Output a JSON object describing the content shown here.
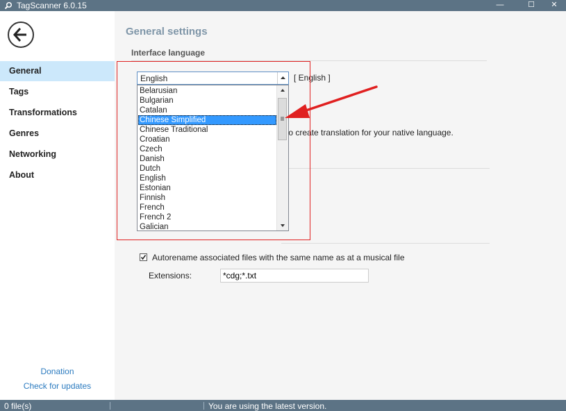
{
  "window": {
    "title": "TagScanner 6.0.15",
    "controls": {
      "minimize": "—",
      "maximize": "☐",
      "close": "✕"
    }
  },
  "sidebar": {
    "items": [
      {
        "label": "General",
        "active": true
      },
      {
        "label": "Tags",
        "active": false
      },
      {
        "label": "Transformations",
        "active": false
      },
      {
        "label": "Genres",
        "active": false
      },
      {
        "label": "Networking",
        "active": false
      },
      {
        "label": "About",
        "active": false
      }
    ],
    "donation": "Donation",
    "check_updates": "Check for updates"
  },
  "main": {
    "page_title": "General settings",
    "interface_language": {
      "section_title": "Interface language",
      "selected": "English",
      "current": "[ English ]",
      "hint_partial": "to create translation for your native language.",
      "options": [
        "Belarusian",
        "Bulgarian",
        "Catalan",
        "Chinese Simplified",
        "Chinese Traditional",
        "Croatian",
        "Czech",
        "Danish",
        "Dutch",
        "English",
        "Estonian",
        "Finnish",
        "French",
        "French 2",
        "Galician"
      ],
      "highlighted_option": "Chinese Simplified"
    },
    "autorename": {
      "checked": true,
      "label": "Autorename associated files with the same name as at a musical file",
      "extensions_label": "Extensions:",
      "extensions_value": "*cdg;*.txt"
    }
  },
  "statusbar": {
    "files": "0 file(s)",
    "message": "You are using the latest version."
  },
  "colors": {
    "titlebar": "#5c7385",
    "accent_selected": "#3399ff",
    "nav_active": "#cce8fb",
    "annotation": "#e02020",
    "link": "#2a7abf"
  }
}
